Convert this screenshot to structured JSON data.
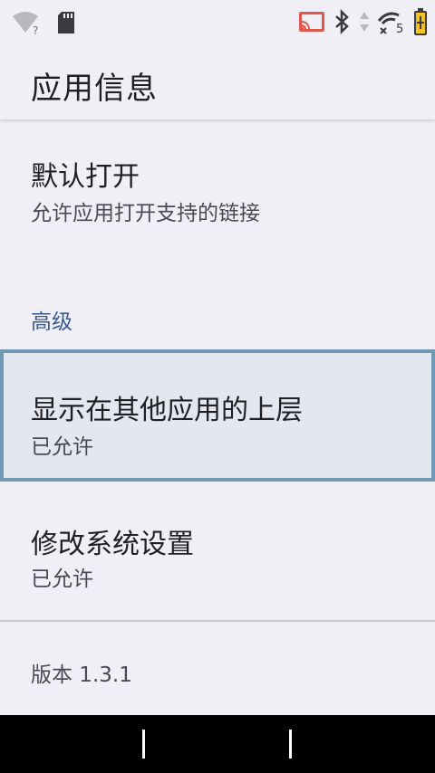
{
  "status_bar": {
    "left_icons": [
      "wifi-unknown-icon",
      "sd-card-icon"
    ],
    "wifi_badge": "?",
    "right_icons": [
      "cast-icon",
      "bluetooth-icon",
      "data-arrows-icon",
      "signal-icon",
      "battery-charging-icon"
    ],
    "signal_badge": "5",
    "battery_color": "#f3c31e"
  },
  "app_bar": {
    "title": "应用信息"
  },
  "items": {
    "default_open": {
      "title": "默认打开",
      "summary": "允许应用打开支持的链接"
    },
    "overlay": {
      "title": "显示在其他应用的上层",
      "summary": "已允许"
    },
    "system_settings": {
      "title": "修改系统设置",
      "summary": "已允许"
    }
  },
  "section": {
    "advanced_label": "高级"
  },
  "version": {
    "text": "版本 1.3.1"
  },
  "colors": {
    "background": "#f0eff6",
    "section_header": "#3b5b8c",
    "focus_border": "#7299b3",
    "focus_fill": "#e3e7f0"
  }
}
